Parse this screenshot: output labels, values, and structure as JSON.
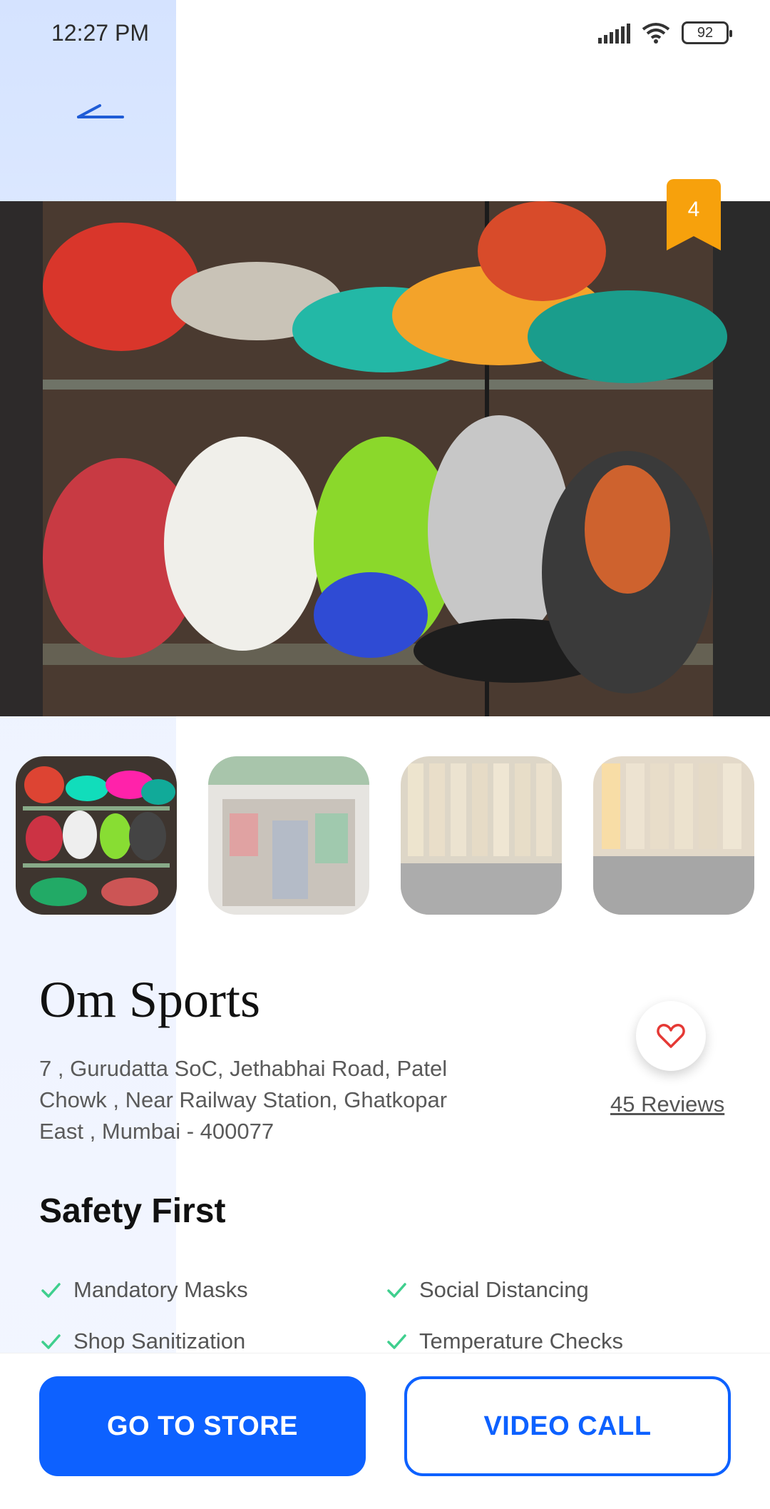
{
  "status_bar": {
    "time": "12:27 PM",
    "battery": "92"
  },
  "badge": {
    "count": "4"
  },
  "thumbnails": [
    {
      "name": "Shoes display"
    },
    {
      "name": "Store front"
    },
    {
      "name": "Cricket bats"
    },
    {
      "name": "Bats rack"
    }
  ],
  "shop": {
    "title": "Om Sports",
    "address": " 7 , Gurudatta SoC, Jethabhai Road, Patel Chowk , Near Railway Station, Ghatkopar East , Mumbai - 400077",
    "reviews": "45 Reviews"
  },
  "safety": {
    "title": "Safety First",
    "items": [
      "Mandatory Masks",
      "Social Distancing",
      "Shop Sanitization",
      "Temperature Checks"
    ]
  },
  "actions": {
    "primary": "GO TO STORE",
    "secondary": "VIDEO CALL"
  },
  "colors": {
    "accent": "#0d61ff",
    "badge": "#f7a10c",
    "check": "#3fcf8e",
    "heart": "#e53935"
  }
}
